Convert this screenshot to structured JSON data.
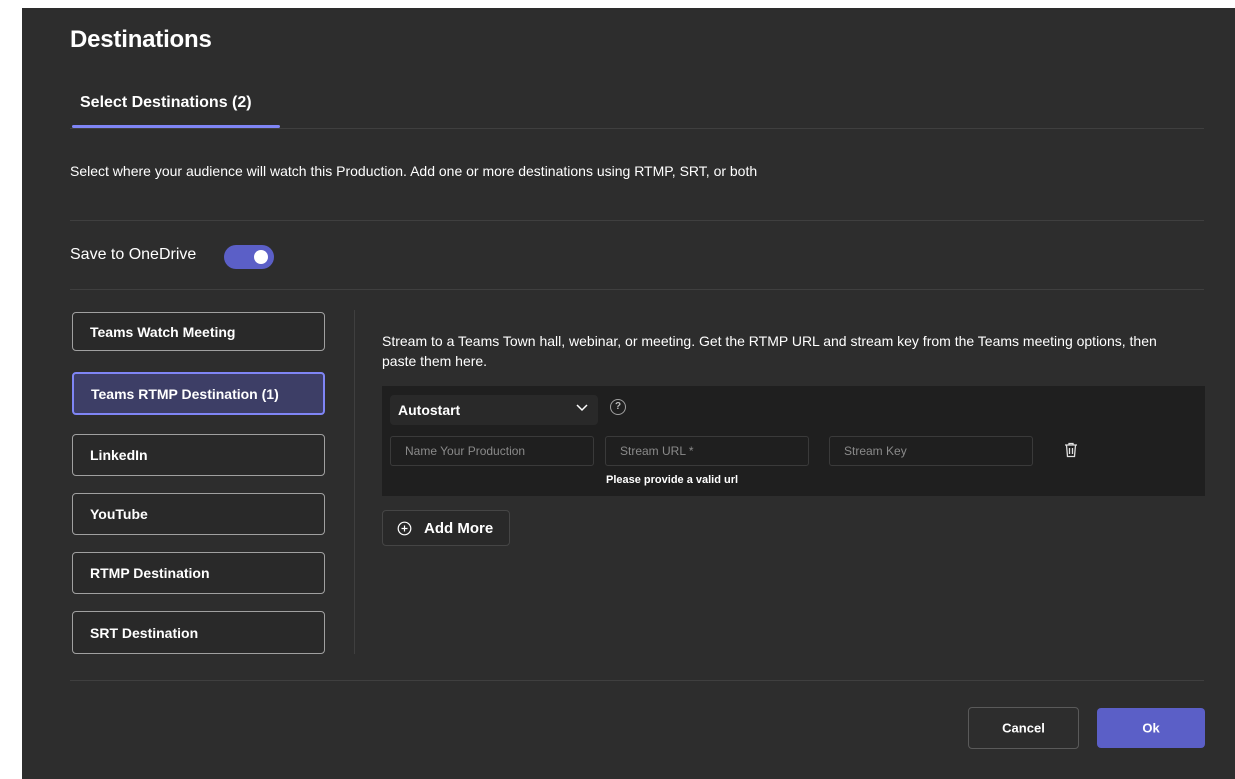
{
  "dialog": {
    "title": "Destinations",
    "tab_label": "Select Destinations (2)",
    "description": "Select where your audience will watch this Production. Add one or more destinations using RTMP, SRT, or both"
  },
  "onedrive": {
    "label": "Save to OneDrive",
    "enabled": true,
    "accent_color": "#5b5fc7"
  },
  "destinations": [
    {
      "label": "Teams Watch Meeting",
      "selected": false
    },
    {
      "label": "Teams RTMP Destination (1)",
      "selected": true
    },
    {
      "label": "LinkedIn",
      "selected": false
    },
    {
      "label": "YouTube",
      "selected": false
    },
    {
      "label": "RTMP Destination",
      "selected": false
    },
    {
      "label": "SRT Destination",
      "selected": false
    }
  ],
  "panel": {
    "description": "Stream to a Teams Town hall, webinar, or meeting. Get the RTMP URL and stream key from the Teams meeting options, then paste them here.",
    "autostart": {
      "value": "Autostart",
      "icon": "chevron-down-icon"
    },
    "help_icon": "question-circle-icon",
    "help_glyph": "?",
    "fields": {
      "name_placeholder": "Name Your Production",
      "url_placeholder": "Stream URL *",
      "key_placeholder": "Stream Key"
    },
    "delete_icon": "trash-icon",
    "error": "Please provide a valid url",
    "add_more": "Add More"
  },
  "footer": {
    "cancel": "Cancel",
    "ok": "Ok"
  },
  "colors": {
    "background": "#2d2d2d",
    "accent": "#5b5fc7",
    "selected_border": "#7f85f5"
  }
}
